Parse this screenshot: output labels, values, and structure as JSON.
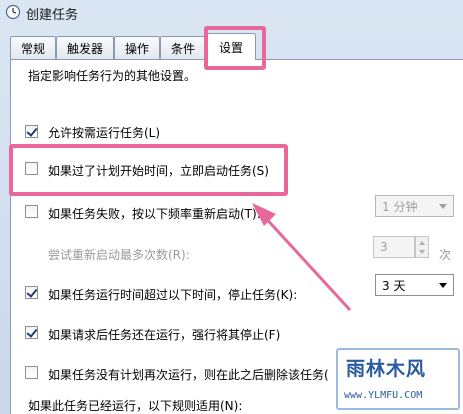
{
  "window": {
    "title": "创建任务"
  },
  "tabs": [
    {
      "label": "常规"
    },
    {
      "label": "触发器"
    },
    {
      "label": "操作"
    },
    {
      "label": "条件"
    },
    {
      "label": "设置"
    }
  ],
  "settings": {
    "intro": "指定影响任务行为的其他设置。",
    "allow_on_demand": {
      "label": "允许按需运行任务(L)",
      "checked": true
    },
    "run_missed": {
      "label": "如果过了计划开始时间，立即启动任务(S)",
      "checked": false
    },
    "restart_on_fail": {
      "label": "如果任务失败，按以下频率重新启动(T):",
      "checked": false,
      "interval": "1 分钟"
    },
    "restart_attempts": {
      "label": "尝试重新启动最多次数(R):",
      "value": "3",
      "unit": "次"
    },
    "stop_if_longer": {
      "label": "如果任务运行时间超过以下时间，停止任务(K):",
      "checked": true,
      "duration": "3 天"
    },
    "force_stop": {
      "label": "如果请求后任务还在运行，强行将其停止(F)",
      "checked": true
    },
    "delete_if_not_scheduled": {
      "label": "如果任务没有计划再次运行，则在此之后删除该任务(",
      "checked": false
    },
    "already_running": {
      "label": "如果此任务已经运行，以下规则适用(N):"
    }
  },
  "watermark": {
    "logo": "雨林木风",
    "url": "www.YLMFU.COM"
  },
  "colors": {
    "highlight": "#e8689b",
    "check": "#1f3d78"
  }
}
